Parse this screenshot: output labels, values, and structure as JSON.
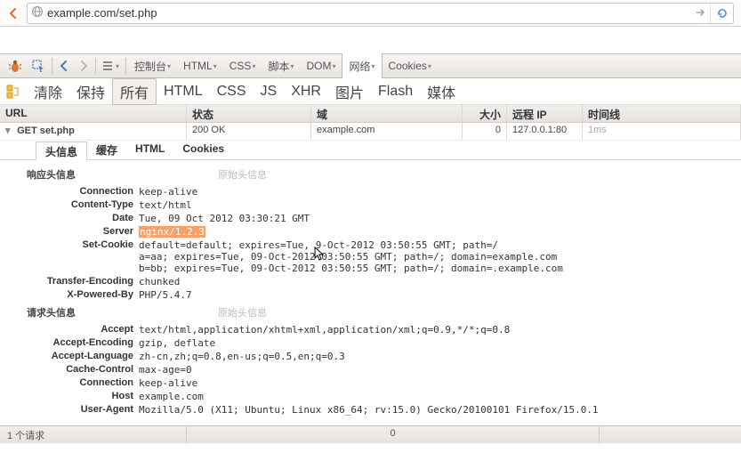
{
  "browser": {
    "url": "example.com/set.php"
  },
  "panel_tabs": {
    "console": "控制台",
    "html": "HTML",
    "css": "CSS",
    "script": "脚本",
    "dom": "DOM",
    "net": "网络",
    "cookies": "Cookies"
  },
  "sub_tabs": {
    "clear": "清除",
    "persist": "保持",
    "all": "所有",
    "html": "HTML",
    "css": "CSS",
    "js": "JS",
    "xhr": "XHR",
    "images": "图片",
    "flash": "Flash",
    "media": "媒体"
  },
  "net_header": {
    "url": "URL",
    "status": "状态",
    "domain": "域",
    "size": "大小",
    "ip": "远程 IP",
    "timeline": "时间线"
  },
  "request": {
    "method": "GET",
    "file": "set.php",
    "status": "200 OK",
    "domain": "example.com",
    "size": "0",
    "ip": "127.0.0.1:80",
    "time": "1ms"
  },
  "detail_tabs": {
    "headers": "头信息",
    "cache": "缓存",
    "html": "HTML",
    "cookies": "Cookies"
  },
  "sections": {
    "response_title": "响应头信息",
    "request_title": "请求头信息",
    "raw": "原始头信息"
  },
  "response_headers": {
    "connection": {
      "name": "Connection",
      "value": "keep-alive"
    },
    "content_type": {
      "name": "Content-Type",
      "value": "text/html"
    },
    "date": {
      "name": "Date",
      "value": "Tue, 09 Oct 2012 03:30:21 GMT"
    },
    "server": {
      "name": "Server",
      "value": "nginx/1.2.3"
    },
    "set_cookie": {
      "name": "Set-Cookie",
      "line1a": "default=default; expires=Tue, ",
      "line1b": "9-Oct-2012 03:50:55 GMT; path=/",
      "line2": "a=aa; expires=Tue, 09-Oct-2012 03:50:55 GMT; path=/; domain=example.com",
      "line3": "b=bb; expires=Tue, 09-Oct-2012 03:50:55 GMT; path=/; domain=.example.com"
    },
    "transfer_encoding": {
      "name": "Transfer-Encoding",
      "value": "chunked"
    },
    "x_powered_by": {
      "name": "X-Powered-By",
      "value": "PHP/5.4.7"
    }
  },
  "request_headers": {
    "accept": {
      "name": "Accept",
      "value": "text/html,application/xhtml+xml,application/xml;q=0.9,*/*;q=0.8"
    },
    "accept_encoding": {
      "name": "Accept-Encoding",
      "value": "gzip, deflate"
    },
    "accept_language": {
      "name": "Accept-Language",
      "value": "zh-cn,zh;q=0.8,en-us;q=0.5,en;q=0.3"
    },
    "cache_control": {
      "name": "Cache-Control",
      "value": "max-age=0"
    },
    "connection": {
      "name": "Connection",
      "value": "keep-alive"
    },
    "host": {
      "name": "Host",
      "value": "example.com"
    },
    "user_agent": {
      "name": "User-Agent",
      "value": "Mozilla/5.0 (X11; Ubuntu; Linux x86_64; rv:15.0) Gecko/20100101 Firefox/15.0.1"
    }
  },
  "status_bar": {
    "requests": "1 个请求",
    "size": "0"
  }
}
